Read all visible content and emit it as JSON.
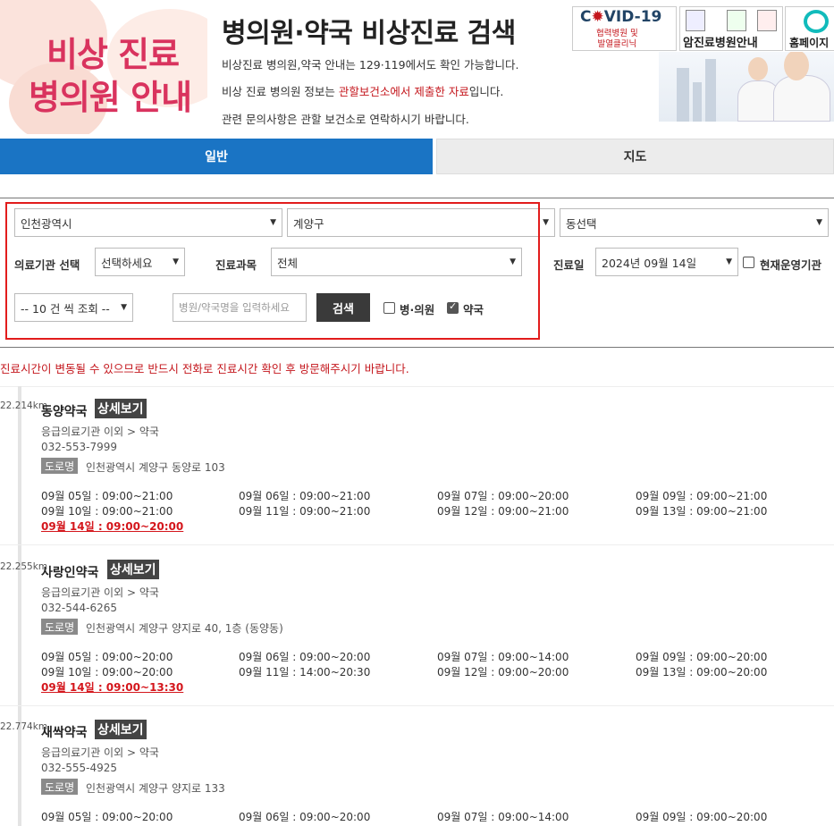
{
  "header": {
    "logo_line1": "비상 진료",
    "logo_line2": "병의원 안내",
    "title": "병의원·약국 비상진료 검색",
    "desc1": "비상진료 병의원,약국 안내는 129·119에서도 확인 가능합니다.",
    "desc2_pre": "비상 진료 병의원 정보는 ",
    "desc2_hl": "관할보건소에서 제출한 자료",
    "desc2_post": "입니다.",
    "desc3": "관련 문의사항은 관할 보건소로 연락하시기 바랍니다."
  },
  "banners": {
    "covid_pre": "C",
    "covid_post": "VID-19",
    "covid_sub1": "협력병원 및",
    "covid_sub2": "발열클리닉",
    "cancer": "암진료병원안내",
    "home": "홈페이지"
  },
  "tabs": {
    "general": "일반",
    "map": "지도"
  },
  "search": {
    "city": "인천광역시",
    "district": "계양구",
    "dong": "동선택",
    "inst_label": "의료기관 선택",
    "inst_value": "선택하세요",
    "dept_label": "진료과목",
    "dept_value": "전체",
    "date_label": "진료일",
    "date_value": "2024년 09월 14일",
    "open_now": "현재운영기관",
    "page_size": "-- 10 건 씩 조회 --",
    "name_placeholder": "병원/약국명을 입력하세요",
    "search_btn": "검색",
    "hospital": "병·의원",
    "hospital_checked": false,
    "pharmacy": "약국",
    "pharmacy_checked": true,
    "open_now_checked": false
  },
  "notice": "진료시간이 변동될 수 있으므로 반드시 전화로 진료시간 확인 후 방문해주시기 바랍니다.",
  "detail_label": "상세보기",
  "road_label": "도로명",
  "results": [
    {
      "distance": "22.214km",
      "name": "동양약국",
      "category": "응급의료기관 이외 > 약국",
      "phone": "032-553-7999",
      "address": "인천광역시 계양구 동양로 103",
      "hours": [
        "09월 05일 : 09:00~21:00",
        "09월 06일 : 09:00~21:00",
        "09월 07일 : 09:00~20:00",
        "09월 09일 : 09:00~21:00",
        "09월 10일 : 09:00~21:00",
        "09월 11일 : 09:00~21:00",
        "09월 12일 : 09:00~21:00",
        "09월 13일 : 09:00~21:00",
        "09월 14일 : 09:00~20:00"
      ]
    },
    {
      "distance": "22.255km",
      "name": "사랑인약국",
      "category": "응급의료기관 이외 > 약국",
      "phone": "032-544-6265",
      "address": "인천광역시 계양구 양지로 40, 1층 (동양동)",
      "hours": [
        "09월 05일 : 09:00~20:00",
        "09월 06일 : 09:00~20:00",
        "09월 07일 : 09:00~14:00",
        "09월 09일 : 09:00~20:00",
        "09월 10일 : 09:00~20:00",
        "09월 11일 : 14:00~20:30",
        "09월 12일 : 09:00~20:00",
        "09월 13일 : 09:00~20:00",
        "09월 14일 : 09:00~13:30"
      ]
    },
    {
      "distance": "22.774km",
      "name": "새싹약국",
      "category": "응급의료기관 이외 > 약국",
      "phone": "032-555-4925",
      "address": "인천광역시 계양구 양지로 133",
      "hours": [
        "09월 05일 : 09:00~20:00",
        "09월 06일 : 09:00~20:00",
        "09월 07일 : 09:00~14:00",
        "09월 09일 : 09:00~20:00"
      ]
    }
  ]
}
